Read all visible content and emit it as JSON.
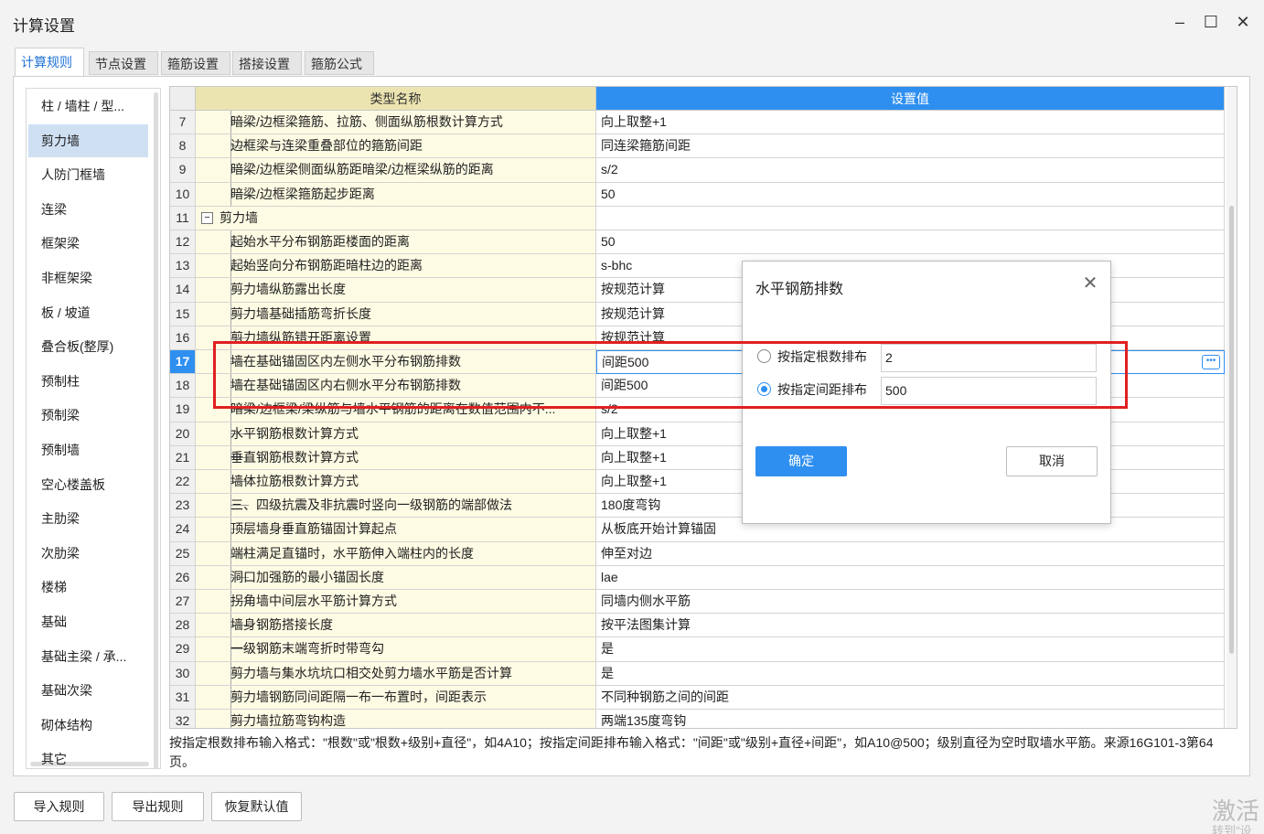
{
  "window": {
    "title": "计算设置",
    "minimize": "–",
    "maximize": "☐",
    "close": "✕"
  },
  "tabs": [
    "计算规则",
    "节点设置",
    "箍筋设置",
    "搭接设置",
    "箍筋公式"
  ],
  "sidebar": {
    "items": [
      "柱 / 墙柱 / 型...",
      "剪力墙",
      "人防门框墙",
      "连梁",
      "框架梁",
      "非框架梁",
      "板 / 坡道",
      "叠合板(整厚)",
      "预制柱",
      "预制梁",
      "预制墙",
      "空心楼盖板",
      "主肋梁",
      "次肋梁",
      "楼梯",
      "基础",
      "基础主梁 / 承...",
      "基础次梁",
      "砌体结构",
      "其它"
    ],
    "selected_index": 1
  },
  "grid": {
    "header": {
      "type": "类型名称",
      "value": "设置值"
    },
    "rows": [
      {
        "num": "7",
        "name": "暗梁/边框梁箍筋、拉筋、侧面纵筋根数计算方式",
        "value": "向上取整+1"
      },
      {
        "num": "8",
        "name": "边框梁与连梁重叠部位的箍筋间距",
        "value": "同连梁箍筋间距"
      },
      {
        "num": "9",
        "name": "暗梁/边框梁侧面纵筋距暗梁/边框梁纵筋的距离",
        "value": "s/2"
      },
      {
        "num": "10",
        "name": "暗梁/边框梁箍筋起步距离",
        "value": "50"
      },
      {
        "num": "11",
        "name": "剪力墙",
        "value": "",
        "group": true
      },
      {
        "num": "12",
        "name": "起始水平分布钢筋距楼面的距离",
        "value": "50"
      },
      {
        "num": "13",
        "name": "起始竖向分布钢筋距暗柱边的距离",
        "value": "s-bhc"
      },
      {
        "num": "14",
        "name": "剪力墙纵筋露出长度",
        "value": "按规范计算"
      },
      {
        "num": "15",
        "name": "剪力墙基础插筋弯折长度",
        "value": "按规范计算"
      },
      {
        "num": "16",
        "name": "剪力墙纵筋错开距离设置",
        "value": "按规范计算"
      },
      {
        "num": "17",
        "name": "墙在基础锚固区内左侧水平分布钢筋排数",
        "value": "间距500",
        "current": true
      },
      {
        "num": "18",
        "name": "墙在基础锚固区内右侧水平分布钢筋排数",
        "value": "间距500"
      },
      {
        "num": "19",
        "name": "暗梁/边框梁/梁纵筋与墙水平钢筋的距离在数值范围内不...",
        "value": "s/2"
      },
      {
        "num": "20",
        "name": "水平钢筋根数计算方式",
        "value": "向上取整+1"
      },
      {
        "num": "21",
        "name": "垂直钢筋根数计算方式",
        "value": "向上取整+1"
      },
      {
        "num": "22",
        "name": "墙体拉筋根数计算方式",
        "value": "向上取整+1"
      },
      {
        "num": "23",
        "name": "三、四级抗震及非抗震时竖向一级钢筋的端部做法",
        "value": "180度弯钩"
      },
      {
        "num": "24",
        "name": "顶层墙身垂直筋锚固计算起点",
        "value": "从板底开始计算锚固"
      },
      {
        "num": "25",
        "name": "端柱满足直锚时，水平筋伸入端柱内的长度",
        "value": "伸至对边"
      },
      {
        "num": "26",
        "name": "洞口加强筋的最小锚固长度",
        "value": "lae"
      },
      {
        "num": "27",
        "name": "拐角墙中间层水平筋计算方式",
        "value": "同墙内侧水平筋"
      },
      {
        "num": "28",
        "name": "墙身钢筋搭接长度",
        "value": "按平法图集计算"
      },
      {
        "num": "29",
        "name": "一级钢筋末端弯折时带弯勾",
        "value": "是"
      },
      {
        "num": "30",
        "name": "剪力墙与集水坑坑口相交处剪力墙水平筋是否计算",
        "value": "是"
      },
      {
        "num": "31",
        "name": "剪力墙钢筋同间距隔一布一布置时，间距表示",
        "value": "不同种钢筋之间的间距"
      },
      {
        "num": "32",
        "name": "剪力墙拉筋弯钩构造",
        "value": "两端135度弯钩"
      }
    ]
  },
  "hint": "按指定根数排布输入格式：\"根数\"或\"根数+级别+直径\"，如4A10；按指定间距排布输入格式：\"间距\"或\"级别+直径+间距\"，如A10@500；级别直径为空时取墙水平筋。来源16G101-3第64页。",
  "footer": {
    "import": "导入规则",
    "export": "导出规则",
    "restore": "恢复默认值"
  },
  "dialog": {
    "title": "水平钢筋排数",
    "option1": {
      "label": "按指定根数排布",
      "value": "2",
      "checked": false
    },
    "option2": {
      "label": "按指定间距排布",
      "value": "500",
      "checked": true
    },
    "ok": "确定",
    "cancel": "取消"
  },
  "watermark": {
    "line1": "激活",
    "line2": "转到\"设"
  },
  "colors": {
    "accent": "#2e8ff0",
    "highlight": "#e02020",
    "type_column": "#fdfbe3"
  }
}
